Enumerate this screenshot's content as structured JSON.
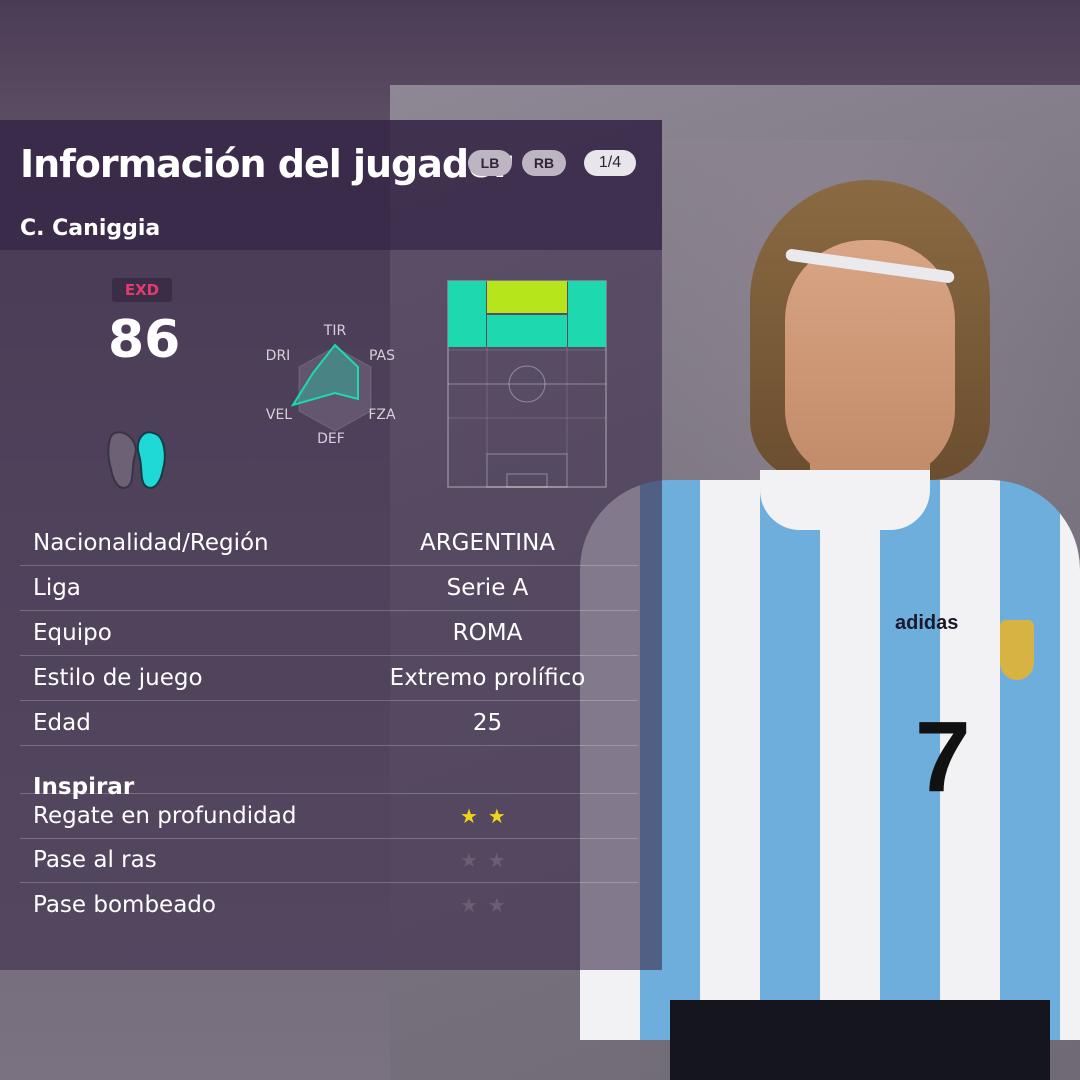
{
  "header": {
    "title": "Información del jugador",
    "lb_label": "LB",
    "rb_label": "RB",
    "page_indicator": "1/4"
  },
  "player": {
    "name": "C. Caniggia",
    "position": "EXD",
    "rating": "86",
    "radar": {
      "labels": [
        "TIR",
        "PAS",
        "FZA",
        "DEF",
        "VEL",
        "DRI"
      ]
    },
    "footedness_icons": [
      "left-foot-icon",
      "right-foot-icon"
    ]
  },
  "info_rows": [
    {
      "label": "Nacionalidad/Región",
      "value": "ARGENTINA"
    },
    {
      "label": "Liga",
      "value": "Serie A"
    },
    {
      "label": "Equipo",
      "value": "ROMA"
    },
    {
      "label": "Estilo de juego",
      "value": "Extremo prolífico"
    },
    {
      "label": "Edad",
      "value": "25"
    }
  ],
  "inspirar": {
    "title": "Inspirar",
    "rows": [
      {
        "label": "Regate en profundidad",
        "stars": "★★",
        "filled": true
      },
      {
        "label": "Pase al ras",
        "stars": "★★",
        "filled": false
      },
      {
        "label": "Pase bombeado",
        "stars": "★★",
        "filled": false
      }
    ]
  },
  "jersey": {
    "brand": "adidas",
    "number": "7"
  },
  "colors": {
    "accent_teal": "#1ed9b0",
    "accent_lime": "#b7e51b",
    "position_badge": "#e23a6e",
    "panel_bg": "#3e2e4e",
    "star_filled": "#f2d21b",
    "star_empty": "#6a5e72"
  }
}
